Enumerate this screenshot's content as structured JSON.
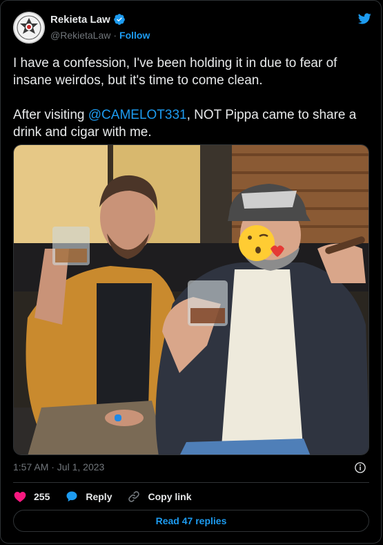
{
  "author": {
    "name": "Rekieta Law",
    "handle": "@RekietaLaw",
    "separator": "·",
    "follow_label": "Follow"
  },
  "tweet": {
    "text_line1": "I have a confession, I've been holding it in due to fear of insane weirdos, but it's time to come clean.",
    "text_before_mention": "After visiting ",
    "mention": "@CAMELOT331",
    "text_after_mention": ", NOT Pippa came to share a drink and cigar with me.",
    "timestamp": "1:57 AM · Jul 1, 2023"
  },
  "actions": {
    "like_count": "255",
    "reply_label": "Reply",
    "copy_link_label": "Copy link"
  },
  "footer": {
    "read_replies_label": "Read 47 replies"
  },
  "colors": {
    "accent": "#1d9bf0",
    "like": "#f91880",
    "background": "#000000"
  },
  "icons": [
    "verified-badge-icon",
    "twitter-bird-icon",
    "info-icon",
    "heart-icon",
    "reply-bubble-icon",
    "link-icon"
  ]
}
